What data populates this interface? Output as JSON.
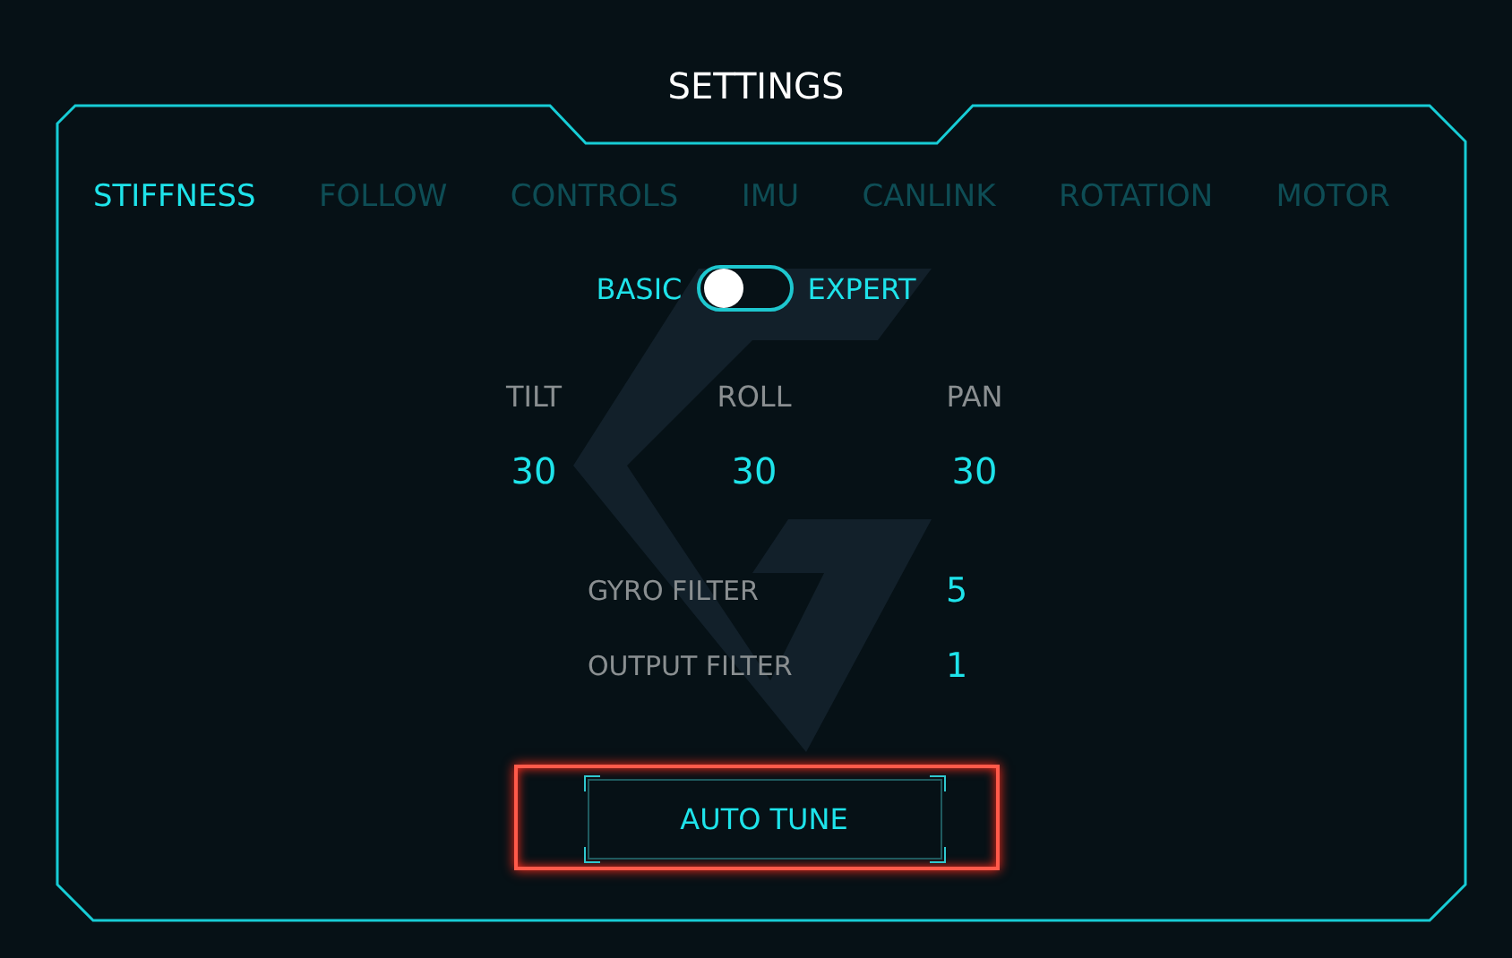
{
  "title": "SETTINGS",
  "tabs": [
    {
      "label": "STIFFNESS",
      "selected": true
    },
    {
      "label": "FOLLOW",
      "selected": false
    },
    {
      "label": "CONTROLS",
      "selected": false
    },
    {
      "label": "IMU",
      "selected": false
    },
    {
      "label": "CANLINK",
      "selected": false
    },
    {
      "label": "ROTATION",
      "selected": false
    },
    {
      "label": "MOTOR",
      "selected": false
    }
  ],
  "mode_toggle": {
    "left_label": "BASIC",
    "right_label": "EXPERT",
    "expert": false
  },
  "axes": [
    {
      "name": "TILT",
      "value": "30"
    },
    {
      "name": "ROLL",
      "value": "30"
    },
    {
      "name": "PAN",
      "value": "30"
    }
  ],
  "filters": [
    {
      "label": "GYRO FILTER",
      "value": "5"
    },
    {
      "label": "OUTPUT FILTER",
      "value": "1"
    }
  ],
  "auto_tune_button": {
    "label": "AUTO TUNE",
    "highlighted": true
  }
}
